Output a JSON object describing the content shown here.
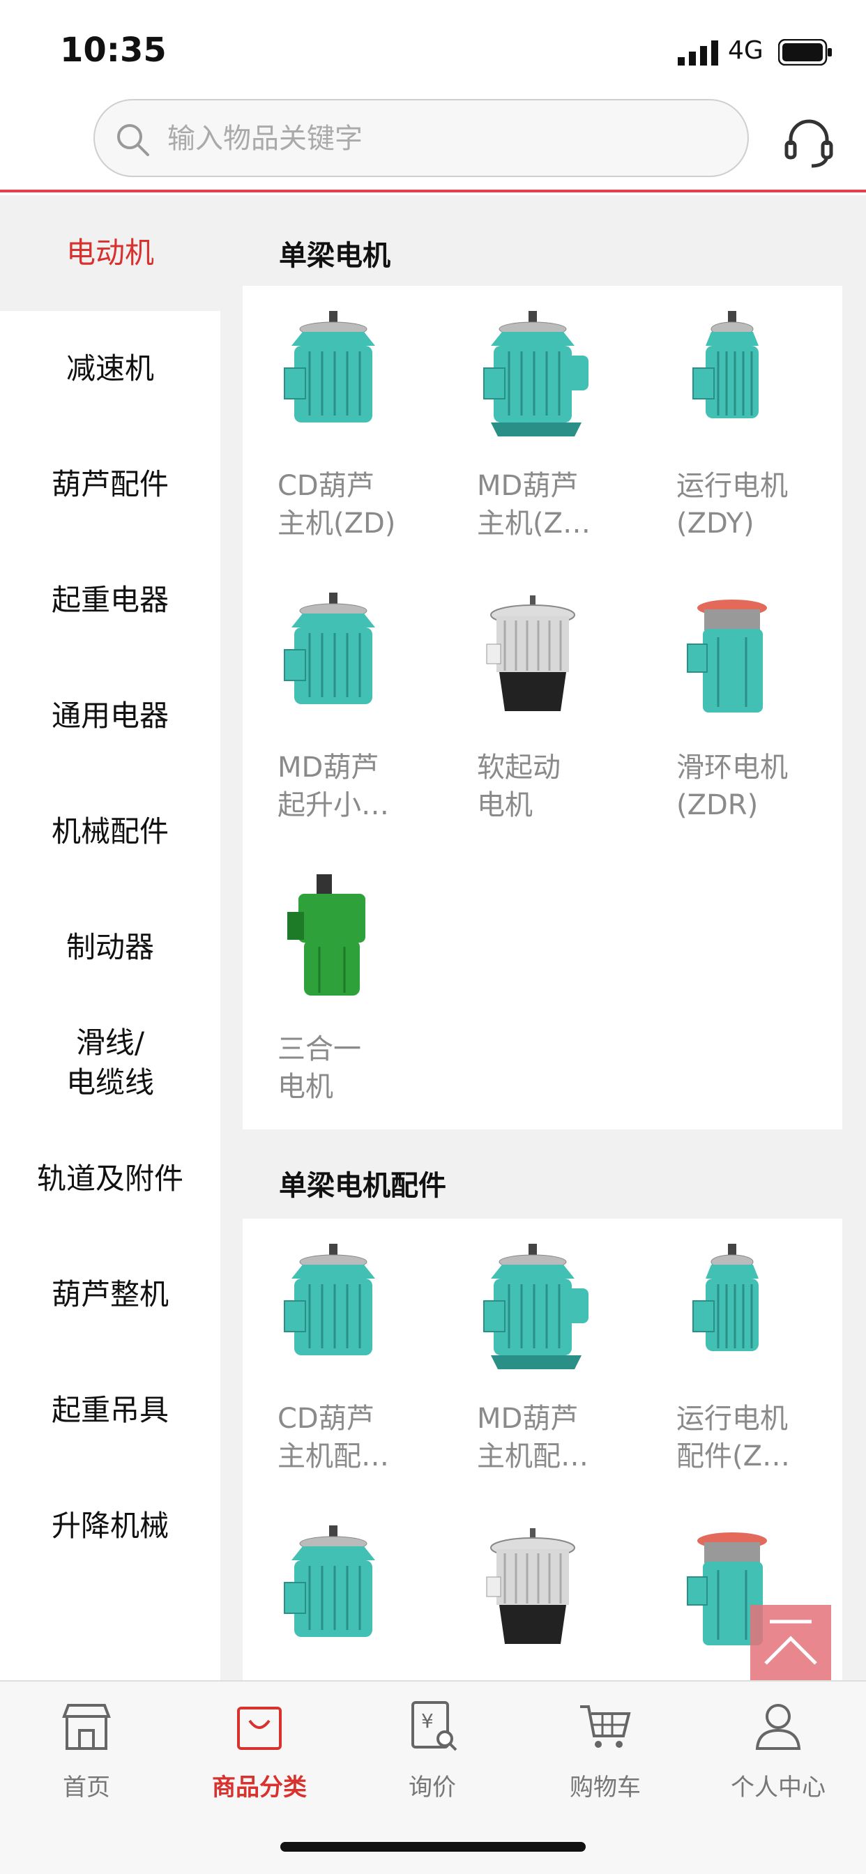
{
  "status": {
    "time": "10:35",
    "network": "4G"
  },
  "search": {
    "placeholder": "输入物品关键字"
  },
  "sidebar": {
    "items": [
      {
        "label": "电动机",
        "active": true
      },
      {
        "label": "减速机"
      },
      {
        "label": "葫芦配件"
      },
      {
        "label": "起重电器"
      },
      {
        "label": "通用电器"
      },
      {
        "label": "机械配件"
      },
      {
        "label": "制动器"
      },
      {
        "label": "滑线/\n电缆线"
      },
      {
        "label": "轨道及附件"
      },
      {
        "label": "葫芦整机"
      },
      {
        "label": "起重吊具"
      },
      {
        "label": "升降机械"
      }
    ]
  },
  "sections": [
    {
      "title": "单梁电机",
      "items": [
        {
          "label": "CD葫芦\n主机(ZD)",
          "icon": "motor-icon-cyan"
        },
        {
          "label": "MD葫芦\n主机(Z…",
          "icon": "motor-icon-cyan-base"
        },
        {
          "label": "运行电机\n(ZDY)",
          "icon": "motor-icon-cyan-small"
        },
        {
          "label": "MD葫芦\n起升小…",
          "icon": "motor-icon-cyan-tall"
        },
        {
          "label": "软起动\n电机",
          "icon": "motor-icon-silver"
        },
        {
          "label": "滑环电机\n(ZDR)",
          "icon": "motor-icon-slipring"
        },
        {
          "label": "三合一\n电机",
          "icon": "motor-icon-green"
        }
      ]
    },
    {
      "title": "单梁电机配件",
      "items": [
        {
          "label": "CD葫芦\n主机配…",
          "icon": "motor-icon-cyan"
        },
        {
          "label": "MD葫芦\n主机配…",
          "icon": "motor-icon-cyan-base"
        },
        {
          "label": "运行电机\n配件(Z…",
          "icon": "motor-icon-cyan-small"
        },
        {
          "label": "",
          "icon": "motor-icon-cyan-tall"
        },
        {
          "label": "",
          "icon": "motor-icon-silver"
        },
        {
          "label": "",
          "icon": "motor-icon-slipring"
        }
      ]
    }
  ],
  "tabs": [
    {
      "label": "首页",
      "icon": "store-icon"
    },
    {
      "label": "商品分类",
      "icon": "bag-icon",
      "active": true
    },
    {
      "label": "询价",
      "icon": "inquiry-icon"
    },
    {
      "label": "购物车",
      "icon": "cart-icon"
    },
    {
      "label": "个人中心",
      "icon": "user-icon"
    }
  ],
  "colors": {
    "accent": "#d8322e",
    "divider": "#e2414b",
    "motor_cyan": "#43c0b4",
    "motor_green": "#2fa13a"
  }
}
